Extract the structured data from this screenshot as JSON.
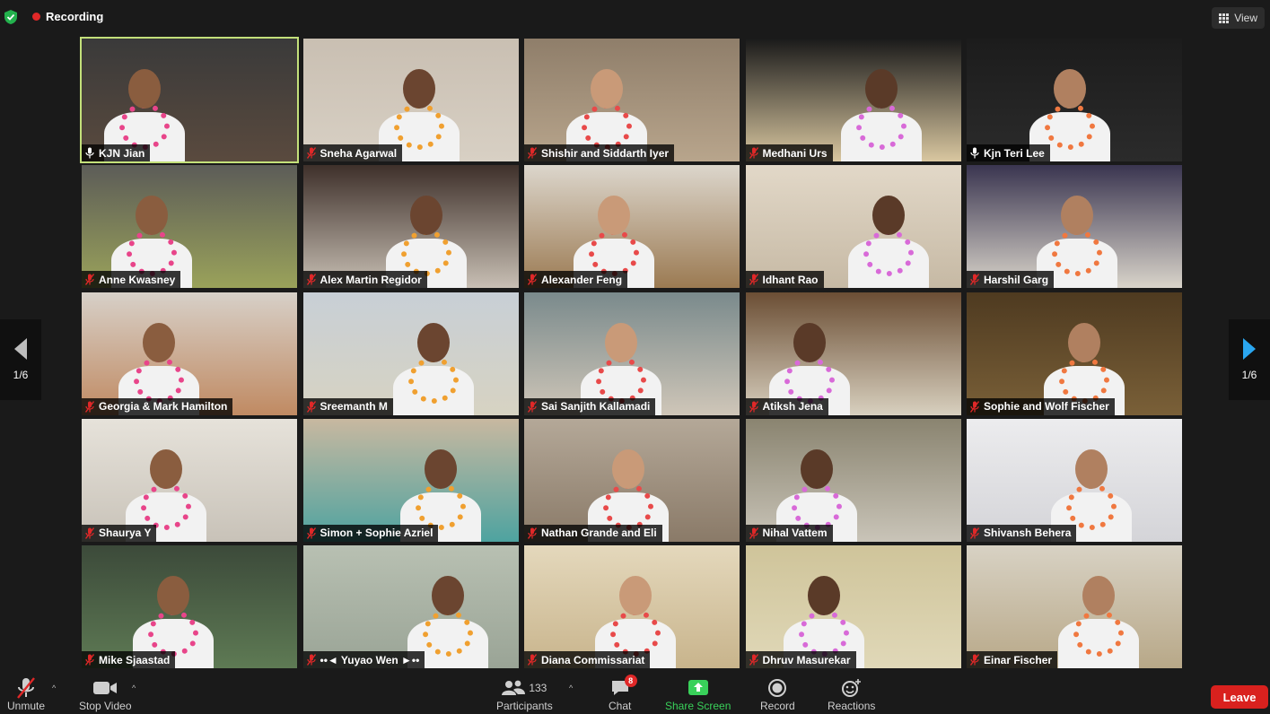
{
  "recording": {
    "label": "Recording"
  },
  "view_button": {
    "label": "View"
  },
  "pagination": {
    "left": "1/6",
    "right": "1/6"
  },
  "participants": [
    {
      "name": "KJN Jian",
      "muted": false,
      "bg": "#5a4a3e",
      "wall": "#3a3a3a"
    },
    {
      "name": "Sneha Agarwal",
      "muted": true,
      "bg": "#d8d0c4",
      "wall": "#c9bfb2"
    },
    {
      "name": "Shishir and Siddarth Iyer",
      "muted": true,
      "bg": "#b8a58c",
      "wall": "#8f7e6a"
    },
    {
      "name": "Medhani Urs",
      "muted": true,
      "bg": "#d9c7a0",
      "wall": "#1a1a1a"
    },
    {
      "name": "Kjn Teri Lee",
      "muted": false,
      "bg": "#2b2b2b",
      "wall": "#1c1c1c"
    },
    {
      "name": "Anne Kwasney",
      "muted": true,
      "bg": "#9aa25a",
      "wall": "#5c5c58"
    },
    {
      "name": "Alex Martin Regidor",
      "muted": true,
      "bg": "#c8bfb4",
      "wall": "#3e302a"
    },
    {
      "name": "Alexander Feng",
      "muted": true,
      "bg": "#9b7a52",
      "wall": "#dcd6cc"
    },
    {
      "name": "Idhant Rao",
      "muted": true,
      "bg": "#c6b9a4",
      "wall": "#e2d8c8"
    },
    {
      "name": "Harshil Garg",
      "muted": true,
      "bg": "#d9d4ca",
      "wall": "#3a3550"
    },
    {
      "name": "Georgia & Mark Hamilton",
      "muted": true,
      "bg": "#c08a62",
      "wall": "#d7d0c8"
    },
    {
      "name": "Sreemanth M",
      "muted": true,
      "bg": "#d7d3c2",
      "wall": "#c8cfd6"
    },
    {
      "name": "Sai Sanjith Kallamadi",
      "muted": true,
      "bg": "#cfc6b8",
      "wall": "#7a8a8c"
    },
    {
      "name": "Atiksh Jena",
      "muted": true,
      "bg": "#d8d0bf",
      "wall": "#6b4e34"
    },
    {
      "name": "Sophie and Wolf Fischer",
      "muted": true,
      "bg": "#7a6038",
      "wall": "#4e3a20"
    },
    {
      "name": "Shaurya Y",
      "muted": true,
      "bg": "#c8c2b8",
      "wall": "#e6e2da"
    },
    {
      "name": "Simon  + Sophie Azriel",
      "muted": true,
      "bg": "#4ea3a0",
      "wall": "#c8b8a0"
    },
    {
      "name": "Nathan Grande and Eli",
      "muted": true,
      "bg": "#8a7a68",
      "wall": "#b4a898"
    },
    {
      "name": "Nihal Vattem",
      "muted": true,
      "bg": "#c9c4b8",
      "wall": "#8a8470"
    },
    {
      "name": "Shivansh Behera",
      "muted": true,
      "bg": "#d4d4d8",
      "wall": "#ececee"
    },
    {
      "name": "Mike Sjaastad",
      "muted": true,
      "bg": "#5e7a54",
      "wall": "#3c4a3a"
    },
    {
      "name": "••◄ Yuyao Wen ►••",
      "muted": true,
      "bg": "#9aa496",
      "wall": "#b8c0b2"
    },
    {
      "name": "Diana Commissariat",
      "muted": true,
      "bg": "#c8b48c",
      "wall": "#e4d8bc"
    },
    {
      "name": "Dhruv Masurekar",
      "muted": true,
      "bg": "#e0d8b8",
      "wall": "#cfc49a"
    },
    {
      "name": "Einar Fischer",
      "muted": true,
      "bg": "#b8a888",
      "wall": "#d8d2c4"
    }
  ],
  "toolbar": {
    "unmute": "Unmute",
    "stop_video": "Stop Video",
    "participants": "Participants",
    "participant_count": "133",
    "chat": "Chat",
    "chat_badge": "8",
    "share_screen": "Share Screen",
    "record": "Record",
    "reactions": "Reactions",
    "leave": "Leave"
  },
  "colors": {
    "active_speaker": "#c3e07a",
    "leave": "#d9211e",
    "share": "#39d15a",
    "muted": "#e02828"
  }
}
